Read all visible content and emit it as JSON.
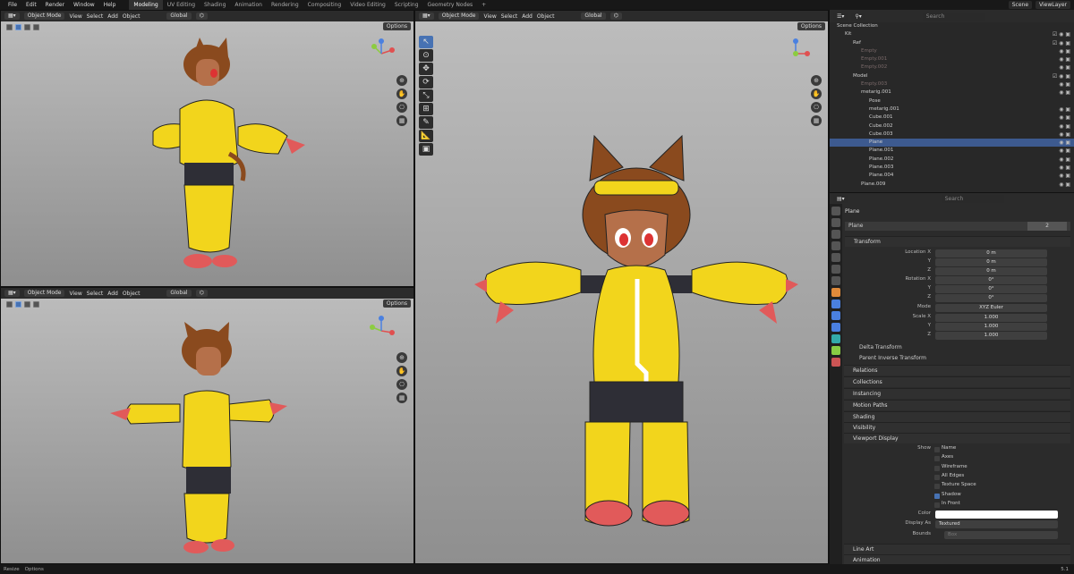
{
  "menu": [
    "File",
    "Edit",
    "Render",
    "Window",
    "Help"
  ],
  "workspaces": [
    "Modeling",
    "UV Editing",
    "Shading",
    "Animation",
    "Rendering",
    "Compositing",
    "Video Editing",
    "Scripting",
    "Geometry Nodes"
  ],
  "active_workspace": "Modeling",
  "scene": "Scene",
  "view_layer": "ViewLayer",
  "viewport": {
    "mode": "Object Mode",
    "menus": [
      "View",
      "Select",
      "Add",
      "Object"
    ],
    "orientation": "Global",
    "options": "Options"
  },
  "outliner": {
    "search_placeholder": "Search",
    "rows": [
      {
        "name": "Scene Collection",
        "indent": 0,
        "vis": ""
      },
      {
        "name": "Kit",
        "indent": 1,
        "vis": "☑ ◉ ▣"
      },
      {
        "name": "Ref",
        "indent": 2,
        "vis": "☑ ◉ ▣"
      },
      {
        "name": "Empty",
        "indent": 3,
        "vis": "◉ ▣",
        "dim": true
      },
      {
        "name": "Empty.001",
        "indent": 3,
        "vis": "◉ ▣",
        "dim": true
      },
      {
        "name": "Empty.002",
        "indent": 3,
        "vis": "◉ ▣",
        "dim": true
      },
      {
        "name": "Model",
        "indent": 2,
        "vis": "☑ ◉ ▣"
      },
      {
        "name": "Empty.003",
        "indent": 3,
        "vis": "◉ ▣",
        "dim": true
      },
      {
        "name": "metarig.001",
        "indent": 3,
        "vis": "◉ ▣"
      },
      {
        "name": "Pose",
        "indent": 4,
        "vis": ""
      },
      {
        "name": "metarig.001",
        "indent": 4,
        "vis": "◉ ▣"
      },
      {
        "name": "Cube.001",
        "indent": 4,
        "vis": "◉ ▣"
      },
      {
        "name": "Cube.002",
        "indent": 4,
        "vis": "◉ ▣"
      },
      {
        "name": "Cube.003",
        "indent": 4,
        "vis": "◉ ▣"
      },
      {
        "name": "Plane",
        "indent": 4,
        "vis": "◉ ▣",
        "selected": true
      },
      {
        "name": "Plane.001",
        "indent": 4,
        "vis": "◉ ▣"
      },
      {
        "name": "Plane.002",
        "indent": 4,
        "vis": "◉ ▣"
      },
      {
        "name": "Plane.003",
        "indent": 4,
        "vis": "◉ ▣"
      },
      {
        "name": "Plane.004",
        "indent": 4,
        "vis": "◉ ▣"
      },
      {
        "name": "Plane.009",
        "indent": 3,
        "vis": "◉ ▣"
      }
    ]
  },
  "props": {
    "search_placeholder": "Search",
    "object_name": "Plane",
    "datablock": "Plane",
    "users": "2",
    "transform": "Transform",
    "location_label": "Location X",
    "rotation_label": "Rotation X",
    "scale_label": "Scale X",
    "y": "Y",
    "z": "Z",
    "loc": [
      "0 m",
      "0 m",
      "0 m"
    ],
    "rot": [
      "0°",
      "0°",
      "0°"
    ],
    "mode_label": "Mode",
    "mode": "XYZ Euler",
    "scale": [
      "1.000",
      "1.000",
      "1.000"
    ],
    "delta": "Delta Transform",
    "parent_inverse": "Parent Inverse Transform",
    "panels": [
      "Relations",
      "Collections",
      "Instancing",
      "Motion Paths",
      "Shading",
      "Visibility"
    ],
    "viewport_display": "Viewport Display",
    "show_label": "Show",
    "show": [
      {
        "label": "Name",
        "on": false
      },
      {
        "label": "Axes",
        "on": false
      },
      {
        "label": "Wireframe",
        "on": false
      },
      {
        "label": "All Edges",
        "on": false
      },
      {
        "label": "Texture Space",
        "on": false
      },
      {
        "label": "Shadow",
        "on": true
      },
      {
        "label": "In Front",
        "on": false
      }
    ],
    "color_label": "Color",
    "display_as_label": "Display As",
    "display_as": "Textured",
    "bounds_label": "Bounds",
    "bounds": "Box",
    "line_art": "Line Art",
    "animation": "Animation"
  },
  "status": {
    "left": "Resize",
    "mid": "Options",
    "version": "5.1"
  },
  "colors": {
    "accent": "#4772b3",
    "yellow": "#f2d51c",
    "skin": "#b5704a",
    "hair": "#8a4a1e",
    "limb": "#e15a5a",
    "dark": "#2e2e36"
  }
}
